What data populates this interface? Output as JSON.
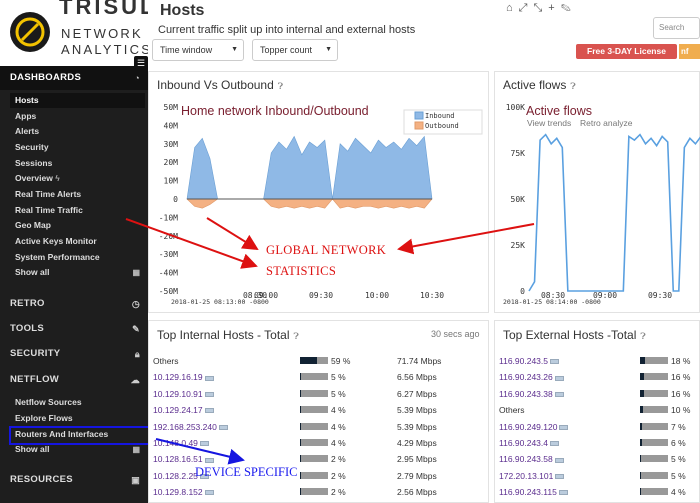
{
  "logo": {
    "brand": "TRISUL",
    "sub1": "NETWORK",
    "sub2": "ANALYTICS"
  },
  "sidebar": {
    "dashboards": "DASHBOARDS",
    "items": [
      "Hosts",
      "Apps",
      "Alerts",
      "Security",
      "Sessions",
      "Overview",
      "Real Time Alerts",
      "Real Time Traffic",
      "Geo Map",
      "Active Keys Monitor",
      "System Performance",
      "Show all"
    ],
    "retro": "RETRO",
    "tools": "TOOLS",
    "security": "SECURITY",
    "netflow": "NETFLOW",
    "netflow_items": [
      "Netflow Sources",
      "Explore Flows",
      "Routers And Interfaces",
      "Show all"
    ],
    "resources": "RESOURCES"
  },
  "header": {
    "title": "Hosts",
    "subtitle": "Current traffic split up into internal and external hosts",
    "time_window": "Time window",
    "topper_count": "Topper count",
    "search_placeholder": "Search",
    "license": "Free 3-DAY License",
    "license2": "nf"
  },
  "panels": {
    "inout_title": "Inbound Vs Outbound",
    "active_title": "Active flows",
    "active_view_trends": "View trends",
    "active_retro": "Retro analyze",
    "internal_title": "Top Internal Hosts - Total",
    "internal_age": "30 secs ago",
    "external_title": "Top External Hosts -Total"
  },
  "chart_data": [
    {
      "type": "area",
      "title": "Inbound Vs Outbound",
      "legend": [
        "Inbound",
        "Outbound"
      ],
      "legend_position": "top-right",
      "y_ticks": [
        "50M",
        "40M",
        "30M",
        "20M",
        "10M",
        "0",
        "-10M",
        "-20M",
        "-30M",
        "-40M",
        "-50M"
      ],
      "x_ticks": [
        "2018-01-25 08:13:00 -0800",
        "08:30",
        "09:00",
        "09:30",
        "10:00",
        "10:30"
      ],
      "series": [
        {
          "name": "Inbound",
          "color": "#8fb9e6",
          "values": [
            0,
            28,
            33,
            22,
            0,
            0,
            0,
            0,
            0,
            0,
            0,
            25,
            31,
            27,
            34,
            24,
            31,
            28,
            32,
            0,
            30,
            26,
            33,
            29,
            25,
            32,
            28,
            31,
            27,
            33,
            29,
            34,
            0
          ]
        },
        {
          "name": "Outbound",
          "color": "#f4b183",
          "values": [
            0,
            -4,
            -5,
            -3,
            0,
            0,
            0,
            0,
            0,
            0,
            0,
            -4,
            -5,
            -4,
            -5,
            -4,
            -5,
            -4,
            -5,
            0,
            -5,
            -4,
            -5,
            -4,
            -4,
            -5,
            -4,
            -5,
            -4,
            -5,
            -4,
            -5,
            0
          ]
        }
      ]
    },
    {
      "type": "line",
      "title": "Active flows",
      "y_ticks": [
        "100K",
        "75K",
        "50K",
        "25K",
        "0"
      ],
      "x_ticks": [
        "2018-01-25 08:14:00 -0800",
        "08:30",
        "09:00",
        "09:30"
      ],
      "series": [
        {
          "name": "Active flows",
          "color": "#5aa0e0",
          "values": [
            0,
            5000,
            82000,
            85000,
            80000,
            83000,
            78000,
            0,
            0,
            0,
            0,
            0,
            0,
            0,
            0,
            0,
            0,
            0,
            84000,
            82000,
            85000,
            80000,
            83000,
            79000,
            84000,
            81000,
            0,
            0,
            78000,
            83000,
            80000,
            84000
          ]
        }
      ]
    }
  ],
  "annotations": {
    "home": "Home network Inbound/Outbound",
    "active": "Active flows",
    "global1": "GLOBAL NETWORK",
    "global2": "STATISTICS",
    "device": "DEVICE SPECIFIC"
  },
  "internal_hosts": [
    {
      "host": "Others",
      "pct": "59 %",
      "pct_val": 59,
      "rate": "71.74 Mbps",
      "link": false
    },
    {
      "host": "10.129.16.19",
      "pct": "5 %",
      "pct_val": 5,
      "rate": "6.56 Mbps",
      "link": true
    },
    {
      "host": "10.129.10.91",
      "pct": "5 %",
      "pct_val": 5,
      "rate": "6.27 Mbps",
      "link": true
    },
    {
      "host": "10.129.24.17",
      "pct": "4 %",
      "pct_val": 4,
      "rate": "5.39 Mbps",
      "link": true
    },
    {
      "host": "192.168.253.240",
      "pct": "4 %",
      "pct_val": 4,
      "rate": "5.39 Mbps",
      "link": true
    },
    {
      "host": "10.148.0.49",
      "pct": "4 %",
      "pct_val": 4,
      "rate": "4.29 Mbps",
      "link": true
    },
    {
      "host": "10.128.16.51",
      "pct": "2 %",
      "pct_val": 2,
      "rate": "2.95 Mbps",
      "link": true
    },
    {
      "host": "10.128.2.25",
      "pct": "2 %",
      "pct_val": 2,
      "rate": "2.79 Mbps",
      "link": true
    },
    {
      "host": "10.129.8.152",
      "pct": "2 %",
      "pct_val": 2,
      "rate": "2.56 Mbps",
      "link": true
    }
  ],
  "external_hosts": [
    {
      "host": "116.90.243.5",
      "pct": "18 %",
      "pct_val": 18,
      "link": true
    },
    {
      "host": "116.90.243.26",
      "pct": "16 %",
      "pct_val": 16,
      "link": true
    },
    {
      "host": "116.90.243.38",
      "pct": "16 %",
      "pct_val": 16,
      "link": true
    },
    {
      "host": "Others",
      "pct": "10 %",
      "pct_val": 10,
      "link": false
    },
    {
      "host": "116.90.249.120",
      "pct": "7 %",
      "pct_val": 7,
      "link": true
    },
    {
      "host": "116.90.243.4",
      "pct": "6 %",
      "pct_val": 6,
      "link": true
    },
    {
      "host": "116.90.243.58",
      "pct": "5 %",
      "pct_val": 5,
      "link": true
    },
    {
      "host": "172.20.13.101",
      "pct": "5 %",
      "pct_val": 5,
      "link": true
    },
    {
      "host": "116.90.243.115",
      "pct": "4 %",
      "pct_val": 4,
      "link": true
    }
  ]
}
